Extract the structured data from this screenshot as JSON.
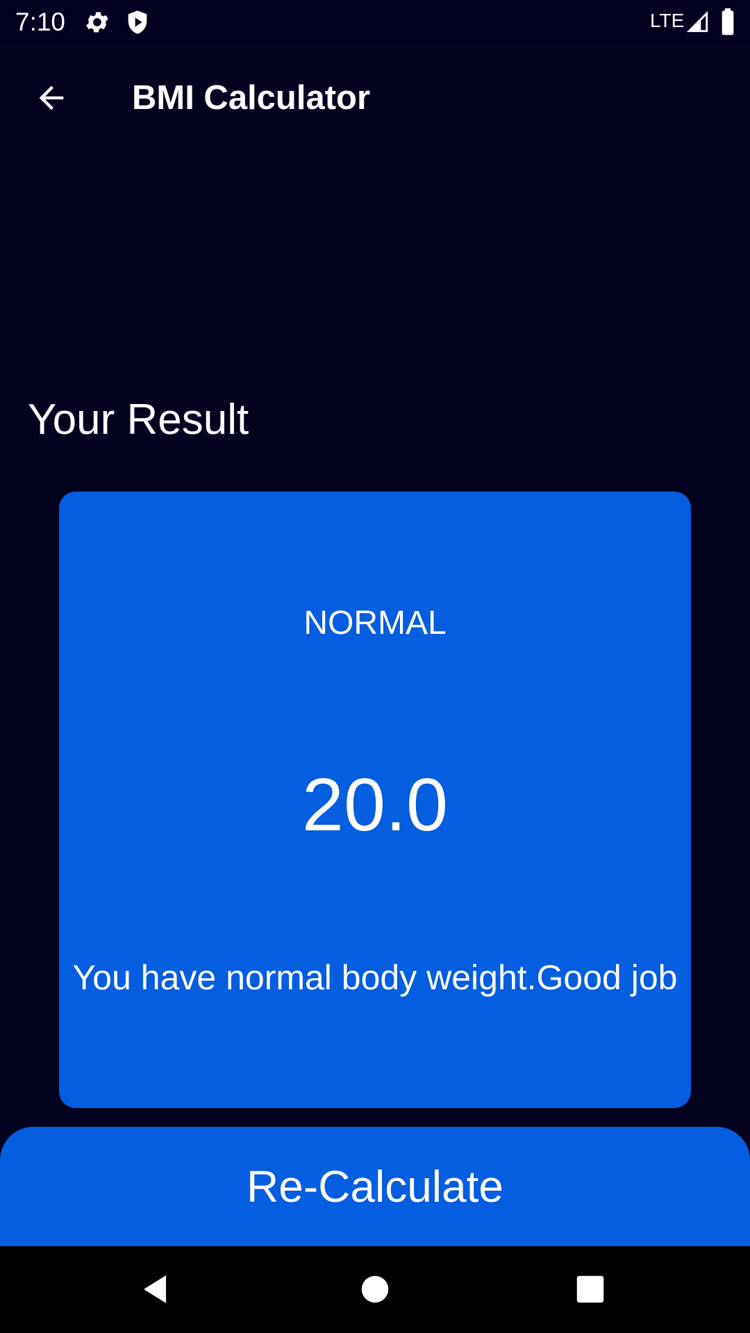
{
  "status_bar": {
    "time": "7:10",
    "network": "LTE",
    "icons": [
      "gear-icon",
      "shield-icon",
      "signal-icon",
      "battery-icon"
    ]
  },
  "app_bar": {
    "title": "BMI Calculator",
    "back_icon": "arrow-left-icon"
  },
  "main": {
    "heading": "Your Result",
    "card": {
      "status": "NORMAL",
      "value": "20.0",
      "message": "You have normal body weight.Good job"
    },
    "recalculate_label": "Re-Calculate"
  },
  "nav_bar": {
    "icons": [
      "back-triangle-icon",
      "home-circle-icon",
      "recents-square-icon"
    ]
  },
  "colors": {
    "background": "#03031F",
    "card": "#055DE0",
    "button": "#055DE0",
    "text": "#FFFFFF"
  }
}
